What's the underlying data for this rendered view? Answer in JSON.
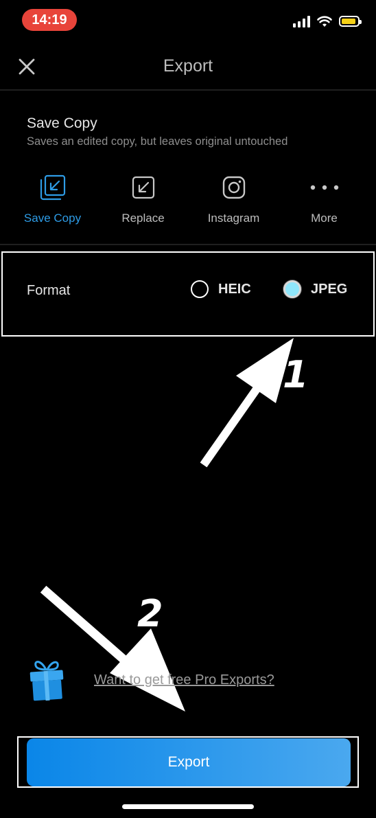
{
  "status_bar": {
    "time": "14:19"
  },
  "header": {
    "title": "Export",
    "close_icon": "close-icon"
  },
  "save_section": {
    "title": "Save Copy",
    "description": "Saves an edited copy, but leaves original untouched"
  },
  "options": [
    {
      "label": "Save Copy",
      "icon": "save-copy-icon",
      "active": true
    },
    {
      "label": "Replace",
      "icon": "replace-icon",
      "active": false
    },
    {
      "label": "Instagram",
      "icon": "instagram-icon",
      "active": false
    },
    {
      "label": "More",
      "icon": "more-icon",
      "active": false
    }
  ],
  "format": {
    "label": "Format",
    "choices": [
      {
        "label": "HEIC",
        "selected": false
      },
      {
        "label": "JPEG",
        "selected": true
      }
    ]
  },
  "annotations": {
    "first": "1",
    "second": "2"
  },
  "promo": {
    "text": "Want to get free Pro Exports?",
    "icon": "gift-icon"
  },
  "export_button": {
    "label": "Export"
  },
  "colors": {
    "accent": "#2e9ce6",
    "button": "#0a86e8",
    "selected_radio": "#8fe6fb",
    "time_pill": "#e8443a"
  }
}
